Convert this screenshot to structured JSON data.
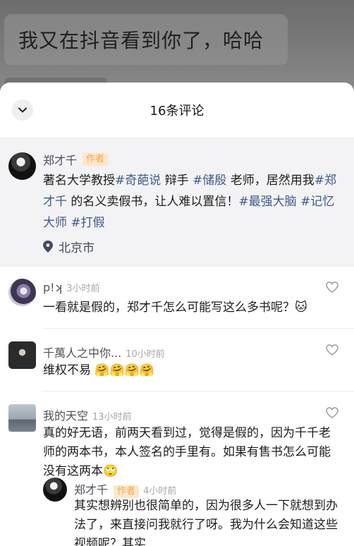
{
  "video": {
    "caption": "我又在抖音看到你了，哈哈"
  },
  "sheet": {
    "title": "16条评论"
  },
  "author_post": {
    "name": "郑才千",
    "badge": "作者",
    "text_segments": [
      {
        "text": "著名大学教授",
        "tag": false
      },
      {
        "text": "#奇葩说",
        "tag": true
      },
      {
        "text": " 辩手 ",
        "tag": false
      },
      {
        "text": "#储殷",
        "tag": true
      },
      {
        "text": " 老师，居然用我",
        "tag": false
      },
      {
        "text": "#郑才千",
        "tag": true
      },
      {
        "text": " 的名义卖假书，让人难以置信！",
        "tag": false
      },
      {
        "text": "#最强大脑",
        "tag": true
      },
      {
        "text": " ",
        "tag": false
      },
      {
        "text": "#记忆大师",
        "tag": true
      },
      {
        "text": " ",
        "tag": false
      },
      {
        "text": "#打假",
        "tag": true
      }
    ],
    "location": "北京市"
  },
  "comments": [
    {
      "name": "p!ʞ",
      "time": "3小时前",
      "text": "一看就是假的，郑才千怎么可能写这么多书呢？",
      "emoji": "🐱"
    },
    {
      "name": "千萬人之中你...",
      "time": "10小时前",
      "text": "维权不易",
      "emoji": "🤗🤗🤗🤗"
    },
    {
      "name": "我的天空",
      "time": "13小时前",
      "text": "真的好无语，前两天看到过，觉得是假的，因为千千老师的两本书，本人签名的手里有。如果有售书怎么可能没有这两本",
      "emoji": "🙄"
    }
  ],
  "reply": {
    "name": "郑才千",
    "badge": "作者",
    "time": "4小时前",
    "text": "其实想辨别也很简单的，因为很多人一下就想到办法了，来直接问我就行了呀。我为什么会知道这些视频呢？其实"
  },
  "icons": {
    "collapse": "chevron-down-icon",
    "location": "location-pin-icon",
    "like": "heart-outline-icon"
  },
  "colors": {
    "tag": "#3f5a8a",
    "badge_text": "#f3a64a",
    "badge_bg": "#fde6cd",
    "author_bg": "#f3f3f5"
  }
}
